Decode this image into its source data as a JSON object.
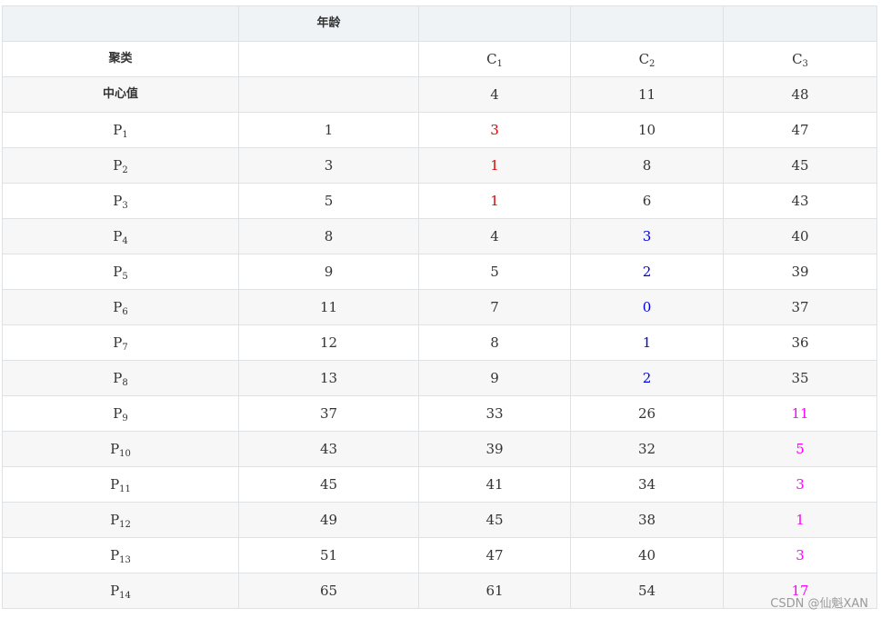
{
  "header": {
    "columns": [
      "",
      "年龄",
      "",
      "",
      ""
    ]
  },
  "labels": {
    "cluster_row": "聚类",
    "center_row": "中心值"
  },
  "clusters": [
    {
      "letter": "C",
      "sub": "1"
    },
    {
      "letter": "C",
      "sub": "2"
    },
    {
      "letter": "C",
      "sub": "3"
    }
  ],
  "centers": [
    "4",
    "11",
    "48"
  ],
  "colors": {
    "text": "#333333",
    "c1_highlight": "#e00000",
    "c2_highlight": "#0000e0",
    "c3_highlight": "#ff00ff",
    "header_bg": "#eff3f5",
    "stripe_bg": "#f7f7f7",
    "border": "#dfe2e5"
  },
  "rows": [
    {
      "letter": "P",
      "sub": "1",
      "age": "1",
      "d": [
        "3",
        "10",
        "47"
      ],
      "highlight": 0
    },
    {
      "letter": "P",
      "sub": "2",
      "age": "3",
      "d": [
        "1",
        "8",
        "45"
      ],
      "highlight": 0
    },
    {
      "letter": "P",
      "sub": "3",
      "age": "5",
      "d": [
        "1",
        "6",
        "43"
      ],
      "highlight": 0
    },
    {
      "letter": "P",
      "sub": "4",
      "age": "8",
      "d": [
        "4",
        "3",
        "40"
      ],
      "highlight": 1
    },
    {
      "letter": "P",
      "sub": "5",
      "age": "9",
      "d": [
        "5",
        "2",
        "39"
      ],
      "highlight": 1
    },
    {
      "letter": "P",
      "sub": "6",
      "age": "11",
      "d": [
        "7",
        "0",
        "37"
      ],
      "highlight": 1
    },
    {
      "letter": "P",
      "sub": "7",
      "age": "12",
      "d": [
        "8",
        "1",
        "36"
      ],
      "highlight": 1
    },
    {
      "letter": "P",
      "sub": "8",
      "age": "13",
      "d": [
        "9",
        "2",
        "35"
      ],
      "highlight": 1
    },
    {
      "letter": "P",
      "sub": "9",
      "age": "37",
      "d": [
        "33",
        "26",
        "11"
      ],
      "highlight": 2
    },
    {
      "letter": "P",
      "sub": "10",
      "age": "43",
      "d": [
        "39",
        "32",
        "5"
      ],
      "highlight": 2
    },
    {
      "letter": "P",
      "sub": "11",
      "age": "45",
      "d": [
        "41",
        "34",
        "3"
      ],
      "highlight": 2
    },
    {
      "letter": "P",
      "sub": "12",
      "age": "49",
      "d": [
        "45",
        "38",
        "1"
      ],
      "highlight": 2
    },
    {
      "letter": "P",
      "sub": "13",
      "age": "51",
      "d": [
        "47",
        "40",
        "3"
      ],
      "highlight": 2
    },
    {
      "letter": "P",
      "sub": "14",
      "age": "65",
      "d": [
        "61",
        "54",
        "17"
      ],
      "highlight": 2
    }
  ],
  "watermark": "CSDN @仙魁XAN"
}
